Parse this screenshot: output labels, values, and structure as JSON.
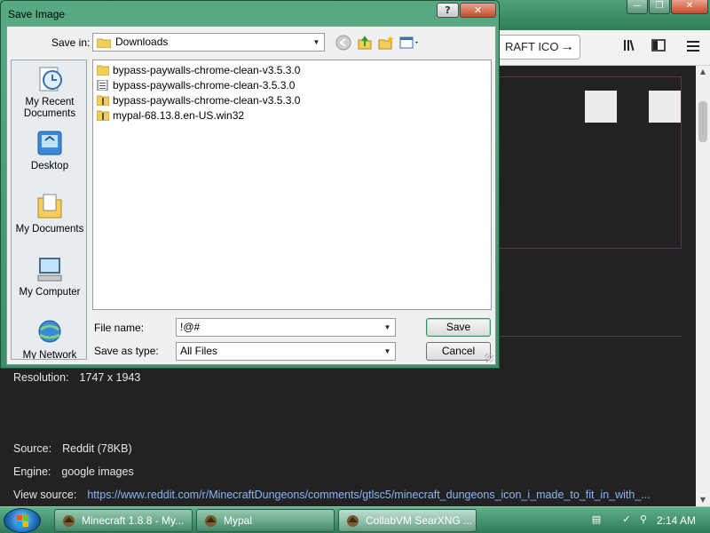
{
  "browser": {
    "url_fragment": "RAFT ICO",
    "info": {
      "resolution_label": "Resolution:",
      "resolution_value": "1747 x 1943",
      "source_label": "Source:",
      "source_value": "Reddit (78KB)",
      "engine_label": "Engine:",
      "engine_value": "google images",
      "view_source_label": "View source:",
      "view_source_value": "https://www.reddit.com/r/MinecraftDungeons/comments/gtlsc5/minecraft_dungeons_icon_i_made_to_fit_in_with_..."
    }
  },
  "dialog": {
    "title": "Save Image",
    "help_label": "?",
    "close_label": "✕",
    "save_in_label": "Save in:",
    "save_in_value": "Downloads",
    "places": [
      {
        "label": "My Recent Documents",
        "icon": "recent-documents-icon"
      },
      {
        "label": "Desktop",
        "icon": "desktop-icon"
      },
      {
        "label": "My Documents",
        "icon": "my-documents-icon"
      },
      {
        "label": "My Computer",
        "icon": "my-computer-icon"
      },
      {
        "label": "My Network",
        "icon": "my-network-icon"
      }
    ],
    "files": [
      {
        "name": "bypass-paywalls-chrome-clean-v3.5.3.0",
        "icon": "folder-icon"
      },
      {
        "name": "bypass-paywalls-chrome-clean-3.5.3.0",
        "icon": "file-icon"
      },
      {
        "name": "bypass-paywalls-chrome-clean-v3.5.3.0",
        "icon": "zip-icon"
      },
      {
        "name": "mypal-68.13.8.en-US.win32",
        "icon": "zip-icon"
      }
    ],
    "file_name_label": "File name:",
    "file_name_value": "!@#",
    "save_as_type_label": "Save as type:",
    "save_as_type_value": "All Files",
    "save_label": "Save",
    "cancel_label": "Cancel"
  },
  "taskbar": {
    "tasks": [
      {
        "label": "Minecraft 1.8.8 - My..."
      },
      {
        "label": "Mypal"
      },
      {
        "label": "CollabVM SearXNG ..."
      }
    ],
    "clock": "2:14 AM"
  },
  "colors": {
    "accent_green": "#3d8f69",
    "link_blue": "#8ab4f8",
    "page_dark": "#222222"
  }
}
